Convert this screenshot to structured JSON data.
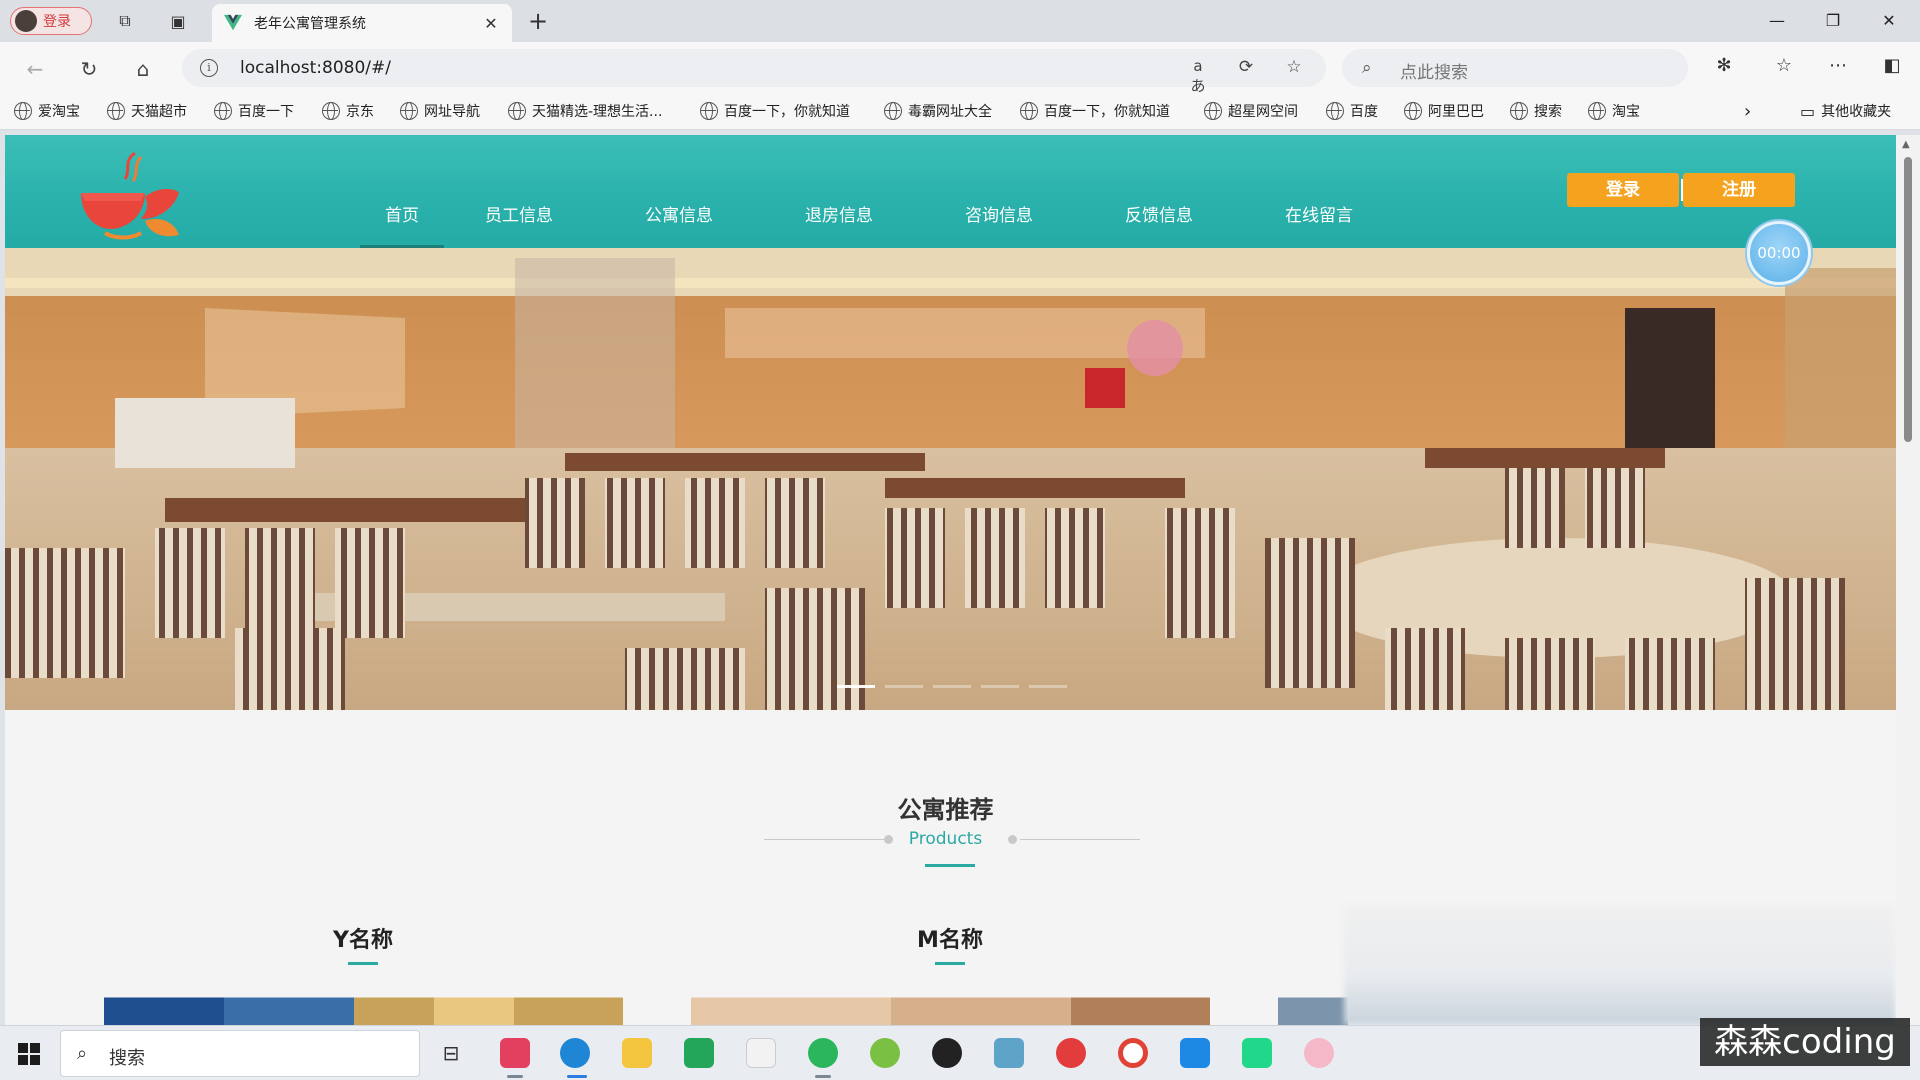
{
  "browser": {
    "profile_label": "登录",
    "tab_title": "老年公寓管理系统",
    "address": "localhost:8080/#/",
    "search_placeholder": "点此搜索",
    "bookmarks": [
      "爱淘宝",
      "天猫超市",
      "百度一下",
      "京东",
      "网址导航",
      "天猫精选-理想生活...",
      "百度一下，你就知道",
      "毒霸网址大全",
      "百度一下，你就知道",
      "超星网空间",
      "百度",
      "阿里巴巴",
      "搜索",
      "淘宝"
    ],
    "other_bookmarks": "其他收藏夹"
  },
  "site": {
    "nav": [
      "首页",
      "员工信息",
      "公寓信息",
      "退房信息",
      "咨询信息",
      "反馈信息",
      "在线留言"
    ],
    "active_nav": "首页",
    "login_label": "登录",
    "register_label": "注册",
    "timer": "00:00",
    "carousel_dots": 5,
    "carousel_active": 0,
    "section": {
      "title": "公寓推荐",
      "subtitle": "Products"
    },
    "products": [
      "Y名称",
      "M名称"
    ]
  },
  "taskbar": {
    "search_label": "搜索"
  },
  "watermark": "森森coding",
  "colors": {
    "header_teal": "#2bb2ac",
    "accent_orange": "#f5a21f",
    "accent_teal": "#2ba9a3"
  }
}
